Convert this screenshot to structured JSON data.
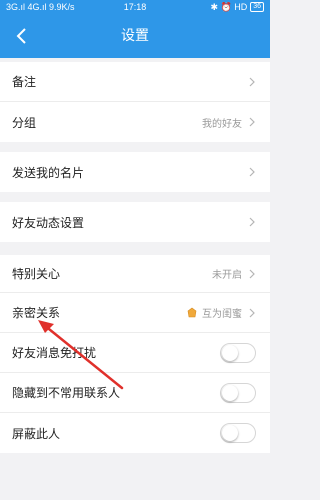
{
  "statusbar": {
    "left": "3G.ıl 4G.ıl 9.9K/s",
    "time": "17:18",
    "right_icons": "✱ ⏰ HD",
    "battery": "36"
  },
  "nav": {
    "title": "设置",
    "back_icon": "chevron-left-icon"
  },
  "settings": {
    "remark": "备注",
    "group": "分组",
    "group_value": "我的好友",
    "send_card": "发送我的名片",
    "dynamic": "好友动态设置",
    "special_care": "特别关心",
    "special_care_value": "未开启",
    "close_relation": "亲密关系",
    "close_relation_value": "互为闺蜜",
    "no_disturb": "好友消息免打扰",
    "no_disturb_on": false,
    "hide_contact": "隐藏到不常用联系人",
    "hide_contact_on": false,
    "block": "屏蔽此人",
    "block_on": false
  },
  "colors": {
    "accent": "#2e97e8",
    "annotation_arrow": "#e0302b",
    "background": "#f2f2f4"
  }
}
